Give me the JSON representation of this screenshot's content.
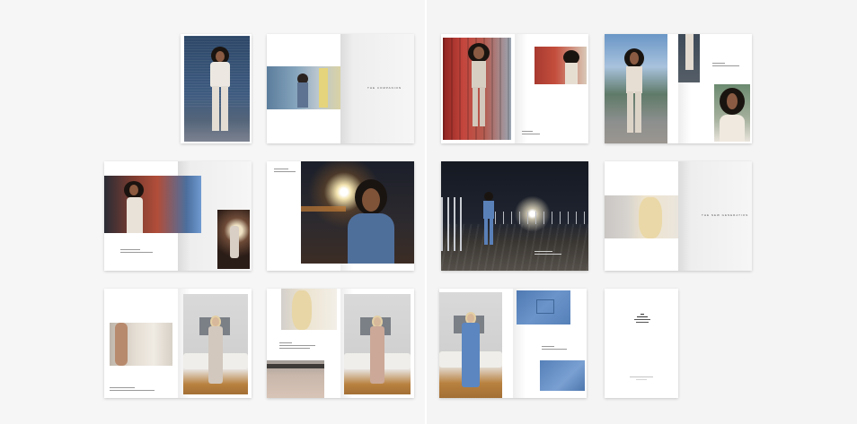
{
  "captions": {
    "s2_right": "THE COMPANION",
    "s10_right": "THE NEW GENERATION"
  },
  "colors": {
    "background": "#f6f6f6",
    "page": "#ffffff",
    "denim": "#5b86c0",
    "cream": "#d9ccc0",
    "night": "#1b1f2a",
    "bridge_red": "#b5413b"
  }
}
